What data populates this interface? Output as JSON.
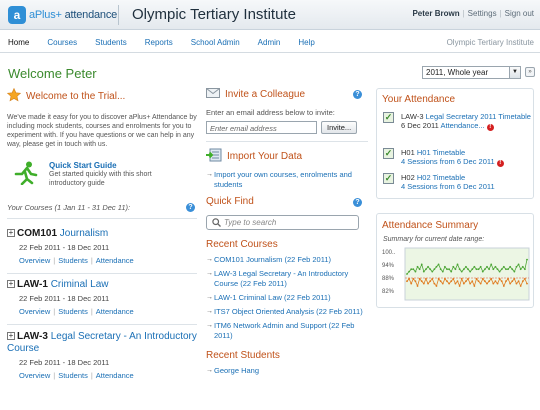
{
  "header": {
    "logo_text_plus": "aPlus+",
    "logo_text_att": "attendance",
    "institute": "Olympic Tertiary Institute",
    "user": "Peter Brown",
    "settings": "Settings",
    "signout": "Sign out"
  },
  "nav": {
    "items": [
      "Home",
      "Courses",
      "Students",
      "Reports",
      "School Admin",
      "Admin",
      "Help"
    ],
    "right": "Olympic Tertiary Institute"
  },
  "welcome": "Welcome Peter",
  "year_select": "2011, Whole year",
  "trial": {
    "title": "Welcome to the Trial...",
    "body": "We've made it easy for you to discover aPlus+ Attendance by including mock students, courses and enrolments for you to experiment with. If you have questions or we can help in any way, please get in touch with us.",
    "guide_title": "Quick Start Guide",
    "guide_body": "Get started quickly with this short introductory guide"
  },
  "your_courses": {
    "heading": "Your Courses (1 Jan 11 - 31 Dec 11):",
    "items": [
      {
        "code": "COM101",
        "name": "Journalism",
        "dates": "22 Feb 2011 - 18 Dec 2011"
      },
      {
        "code": "LAW-1",
        "name": "Criminal Law",
        "dates": "22 Feb 2011 - 18 Dec 2011"
      },
      {
        "code": "LAW-3",
        "name": "Legal Secretary - An Introductory Course",
        "dates": "22 Feb 2011 - 18 Dec 2011"
      }
    ],
    "links": [
      "Overview",
      "Students",
      "Attendance"
    ]
  },
  "invite": {
    "title": "Invite a Colleague",
    "label": "Enter an email address below to invite:",
    "placeholder": "Enter email address",
    "button": "Invite..."
  },
  "import": {
    "title": "Import Your Data",
    "link": "Import your own courses, enrolments and students"
  },
  "quick_find": {
    "title": "Quick Find",
    "placeholder": "Type to search"
  },
  "recent_courses": {
    "title": "Recent Courses",
    "items": [
      "COM101 Journalism (22 Feb 2011)",
      "LAW-3 Legal Secretary - An Introductory Course (22 Feb 2011)",
      "LAW-1 Criminal Law (22 Feb 2011)",
      "ITS7 Object Oriented Analysis (22 Feb 2011)",
      "ITM6 Network Admin and Support (22 Feb 2011)"
    ]
  },
  "recent_students": {
    "title": "Recent Students",
    "items": [
      "George Hang"
    ]
  },
  "your_attendance": {
    "title": "Your Attendance",
    "items": [
      {
        "code": "LAW-3",
        "link": "Legal Secretary 2011 Timetable",
        "detail": "6 Dec 2011",
        "detail_link": "Attendance...",
        "warn": true
      },
      {
        "code": "H01",
        "link": "H01 Timetable",
        "detail": "",
        "detail_link": "4 Sessions from 6 Dec 2011",
        "warn": true
      },
      {
        "code": "H02",
        "link": "H02 Timetable",
        "detail": "",
        "detail_link": "4 Sessions from 6 Dec 2011",
        "warn": false
      }
    ]
  },
  "summary": {
    "title": "Attendance Summary",
    "caption": "Summary for current date range:",
    "yticks": [
      "100..",
      "94%",
      "88%",
      "82%"
    ]
  },
  "chart_data": {
    "type": "line",
    "ylim": [
      80,
      100
    ],
    "yticks": [
      "100..",
      "94%",
      "88%",
      "82%"
    ],
    "series": [
      {
        "values": [
          90,
          91,
          92,
          92,
          91,
          93,
          92,
          94,
          91,
          92,
          93,
          92,
          91,
          92,
          93,
          94,
          92,
          91,
          93,
          92,
          92,
          91,
          93,
          92,
          94,
          92,
          91,
          92,
          93,
          92,
          91,
          92,
          93,
          92,
          92,
          93,
          91,
          92,
          93,
          92,
          94,
          92,
          93,
          92,
          91,
          92,
          93,
          92,
          92,
          93,
          92,
          91,
          93,
          94,
          92,
          93,
          92,
          96
        ]
      },
      {
        "values": [
          87,
          88,
          86,
          88,
          87,
          85,
          88,
          87,
          86,
          88,
          86,
          87,
          88,
          86,
          85,
          88,
          87,
          86,
          88,
          87,
          86,
          87,
          88,
          86,
          87,
          85,
          88,
          86,
          87,
          88,
          86,
          87,
          85,
          88,
          87,
          86,
          88,
          87,
          86,
          87,
          88,
          86,
          87,
          86,
          88,
          87,
          85,
          87,
          88,
          86,
          87,
          88,
          86,
          87,
          85,
          87,
          88,
          86
        ]
      }
    ]
  },
  "colors": {
    "accent": "#1a6fb5",
    "section": "#c0521a",
    "welcome": "#3b8a2e",
    "series_green": "#4ca535",
    "series_orange": "#e07b1f"
  }
}
